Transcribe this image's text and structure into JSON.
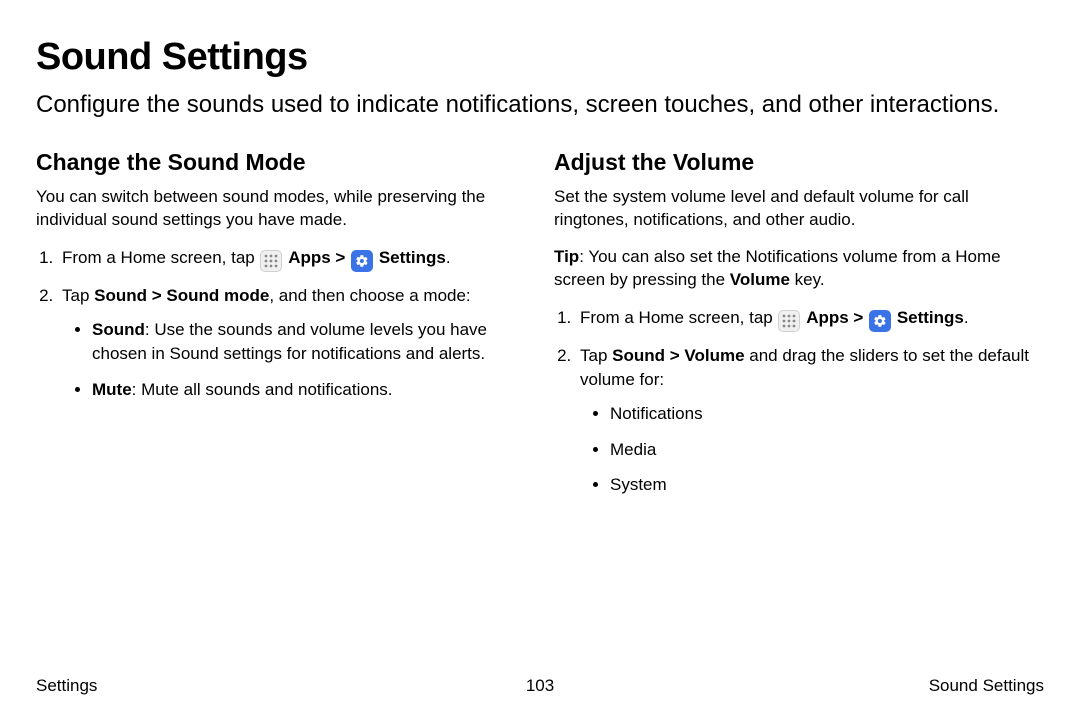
{
  "title": "Sound Settings",
  "intro": "Configure the sounds used to indicate notifications, screen touches, and other interactions.",
  "left": {
    "heading": "Change the Sound Mode",
    "desc": "You can switch between sound modes, while preserving the individual sound settings you have made.",
    "step1_pre": "From a Home screen, tap ",
    "apps": "Apps",
    "chev": " > ",
    "settings": "Settings",
    "step1_post": ".",
    "step2_pre": "Tap ",
    "step2_bold": "Sound > Sound mode",
    "step2_post": ", and then choose a mode:",
    "b1_bold": "Sound",
    "b1_rest": ": Use the sounds and volume levels you have chosen in Sound settings for notifications and alerts.",
    "b2_bold": "Mute",
    "b2_rest": ": Mute all sounds and notifications."
  },
  "right": {
    "heading": "Adjust the Volume",
    "desc": "Set the system volume level and default volume for call ringtones, notifications, and other audio.",
    "tip_bold": "Tip",
    "tip_mid": ": You can also set the Notifications volume from a Home screen by pressing the ",
    "tip_vol": "Volume",
    "tip_end": " key.",
    "step1_pre": "From a Home screen, tap ",
    "apps": "Apps",
    "chev": " > ",
    "settings": "Settings",
    "step1_post": ".",
    "step2_pre": "Tap ",
    "step2_bold": "Sound > Volume",
    "step2_post": " and drag the sliders to set the default volume for:",
    "b1": "Notifications",
    "b2": "Media",
    "b3": "System"
  },
  "footer": {
    "left": "Settings",
    "center": "103",
    "right": "Sound Settings"
  }
}
